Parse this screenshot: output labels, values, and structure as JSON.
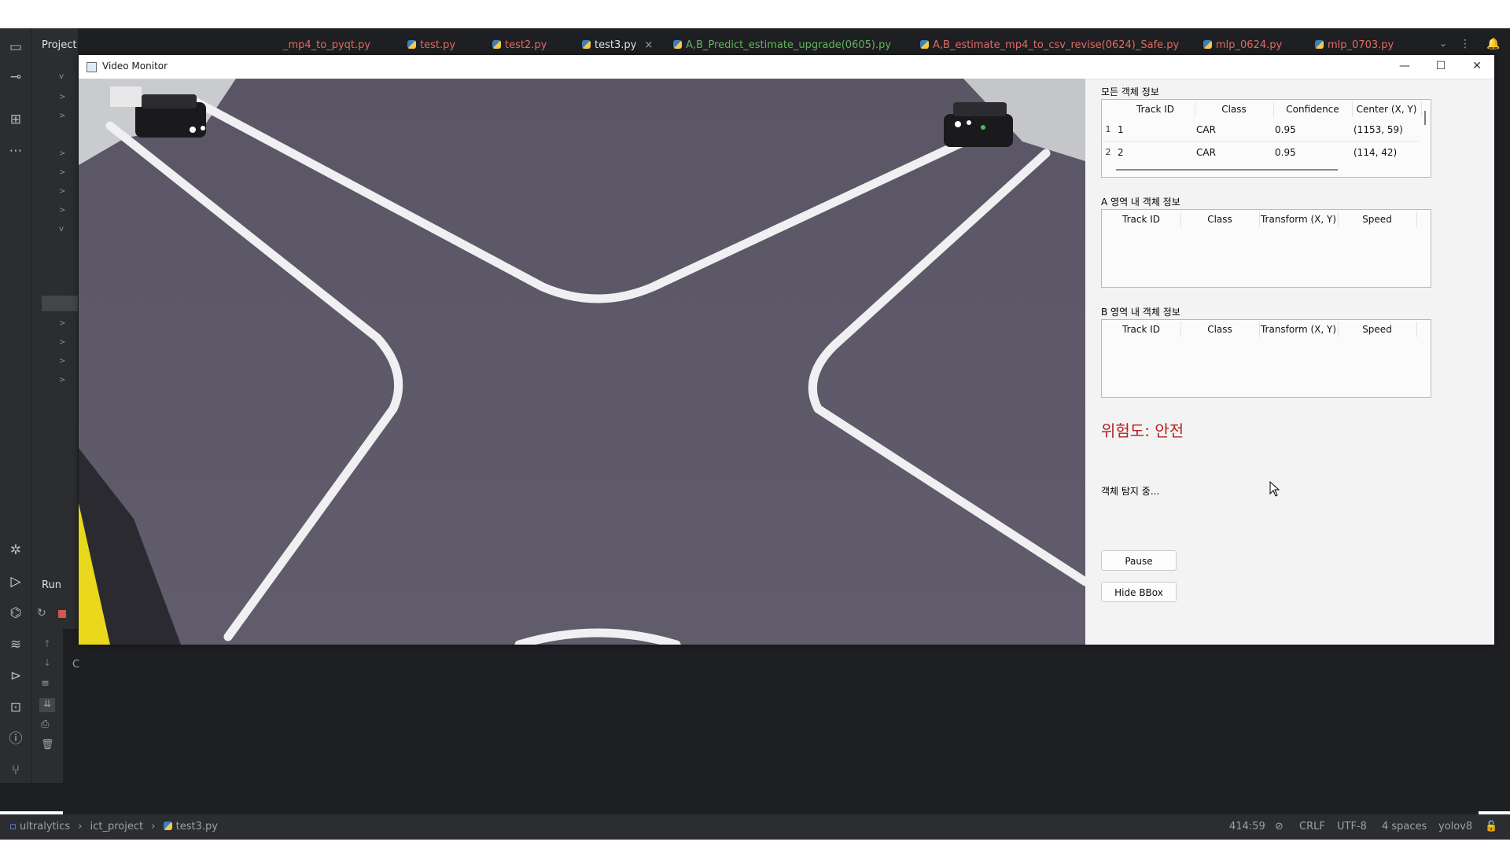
{
  "ide": {
    "project_label": "Project",
    "tabs": [
      {
        "label": "_mp4_to_pyqt.py",
        "color": "#e36b62"
      },
      {
        "label": "test.py",
        "color": "#e36b62"
      },
      {
        "label": "test2.py",
        "color": "#e36b62"
      },
      {
        "label": "test3.py",
        "color": "#dfe1e5",
        "active": true
      },
      {
        "label": "A,B_Predict_estimate_upgrade(0605).py",
        "color": "#5fb65a"
      },
      {
        "label": "A,B_estimate_mp4_to_csv_revise(0624)_Safe.py",
        "color": "#e36b62"
      },
      {
        "label": "mlp_0624.py",
        "color": "#e36b62"
      },
      {
        "label": "mlp_0703.py",
        "color": "#e36b62"
      }
    ],
    "tab_close": "×",
    "run_label": "Run",
    "console_char": "C",
    "statusbar": {
      "breadcrumb": [
        "ultralytics",
        "ict_project",
        "test3.py"
      ],
      "position": "414:59",
      "line_sep": "CRLF",
      "encoding": "UTF-8",
      "indent": "4 spaces",
      "interpreter": "yolov8"
    }
  },
  "window": {
    "title": "Video Monitor",
    "minimize": "—",
    "maximize": "☐",
    "close": "✕"
  },
  "panel": {
    "all_objects": {
      "title": "모든 객체 정보",
      "columns": [
        "Track ID",
        "Class",
        "Confidence",
        "Center (X, Y)"
      ],
      "rows": [
        {
          "num": "1",
          "track_id": "1",
          "class": "CAR",
          "confidence": "0.95",
          "center": "(1153, 59)"
        },
        {
          "num": "2",
          "track_id": "2",
          "class": "CAR",
          "confidence": "0.95",
          "center": "(114, 42)"
        }
      ]
    },
    "zone_a": {
      "title": "A 영역 내 객체 정보",
      "columns": [
        "Track ID",
        "Class",
        "Transform (X, Y)",
        "Speed"
      ]
    },
    "zone_b": {
      "title": "B 영역 내 객체 정보",
      "columns": [
        "Track ID",
        "Class",
        "Transform (X, Y)",
        "Speed"
      ]
    },
    "risk_text": "위험도: 안전",
    "risk_color": "#b22222",
    "status_text": "객체 탐지 중...",
    "pause_label": "Pause",
    "hide_bbox_label": "Hide BBox"
  }
}
